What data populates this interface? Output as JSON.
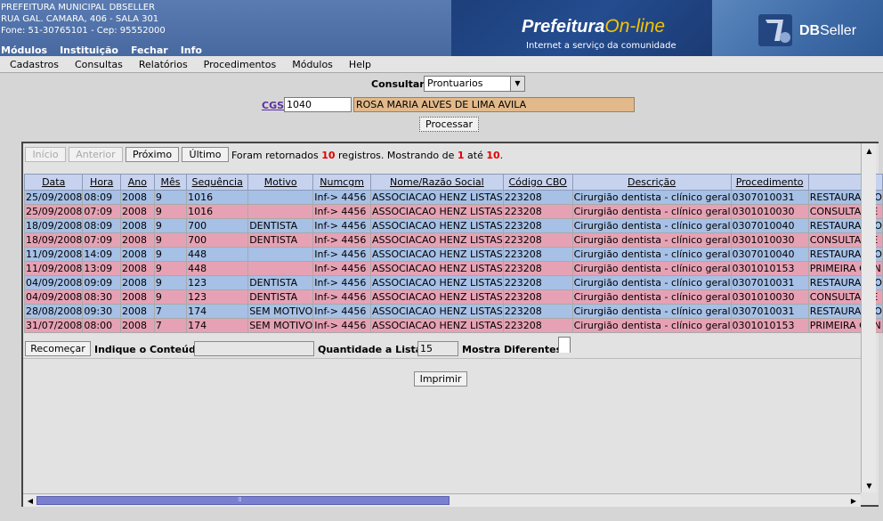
{
  "header": {
    "address_lines": [
      "PREFEITURA MUNICIPAL DBSELLER",
      "RUA GAL. CAMARA, 406 - SALA 301",
      "Fone: 51-30765101  -  Cep: 95552000"
    ],
    "top_menu": [
      "Módulos",
      "Instituição",
      "Fechar",
      "Info"
    ],
    "logo_part1": "Prefeitura",
    "logo_part2": "On-line",
    "logo_sub": "Internet a serviço da comunidade",
    "brand_db": "DB",
    "brand_seller": "Seller"
  },
  "menubar": [
    "Cadastros",
    "Consultas",
    "Relatórios",
    "Procedimentos",
    "Módulos",
    "Help"
  ],
  "form": {
    "consultar_label": "Consultar",
    "consultar_value": "Prontuarios",
    "cgs_label": "CGS",
    "cgs_value": "1040",
    "cgs_name": "ROSA MARIA ALVES DE LIMA AVILA",
    "processar": "Processar"
  },
  "nav": {
    "inicio": "Início",
    "anterior": "Anterior",
    "proximo": "Próximo",
    "ultimo": "Último",
    "info_prefix": "Foram retornados",
    "total": "10",
    "info_mid": "registros. Mostrando de",
    "from": "1",
    "info_to": "até",
    "to": "10",
    "period": "."
  },
  "table": {
    "columns": [
      "Data",
      "Hora",
      "Ano",
      "Mês",
      "Sequência",
      "Motivo",
      "Numcgm",
      "Nome/Razão Social",
      "Código CBO",
      "Descrição",
      "Procedimento",
      ""
    ],
    "rows": [
      [
        "25/09/2008",
        "08:09",
        "2008",
        "9",
        "1016",
        "",
        "Inf-> 4456",
        "ASSOCIACAO HENZ LISTAS",
        "223208",
        "Cirurgião dentista - clínico geral",
        "0307010031",
        "RESTAURACAO"
      ],
      [
        "25/09/2008",
        "07:09",
        "2008",
        "9",
        "1016",
        "",
        "Inf-> 4456",
        "ASSOCIACAO HENZ LISTAS",
        "223208",
        "Cirurgião dentista - clínico geral",
        "0301010030",
        "CONSULTA DE"
      ],
      [
        "18/09/2008",
        "08:09",
        "2008",
        "9",
        "700",
        "DENTISTA",
        "Inf-> 4456",
        "ASSOCIACAO HENZ LISTAS",
        "223208",
        "Cirurgião dentista - clínico geral",
        "0307010040",
        "RESTAURACAO"
      ],
      [
        "18/09/2008",
        "07:09",
        "2008",
        "9",
        "700",
        "DENTISTA",
        "Inf-> 4456",
        "ASSOCIACAO HENZ LISTAS",
        "223208",
        "Cirurgião dentista - clínico geral",
        "0301010030",
        "CONSULTA DE"
      ],
      [
        "11/09/2008",
        "14:09",
        "2008",
        "9",
        "448",
        "",
        "Inf-> 4456",
        "ASSOCIACAO HENZ LISTAS",
        "223208",
        "Cirurgião dentista - clínico geral",
        "0307010040",
        "RESTAURACAO"
      ],
      [
        "11/09/2008",
        "13:09",
        "2008",
        "9",
        "448",
        "",
        "Inf-> 4456",
        "ASSOCIACAO HENZ LISTAS",
        "223208",
        "Cirurgião dentista - clínico geral",
        "0301010153",
        "PRIMEIRA CON"
      ],
      [
        "04/09/2008",
        "09:09",
        "2008",
        "9",
        "123",
        "DENTISTA",
        "Inf-> 4456",
        "ASSOCIACAO HENZ LISTAS",
        "223208",
        "Cirurgião dentista - clínico geral",
        "0307010031",
        "RESTAURACAO"
      ],
      [
        "04/09/2008",
        "08:30",
        "2008",
        "9",
        "123",
        "DENTISTA",
        "Inf-> 4456",
        "ASSOCIACAO HENZ LISTAS",
        "223208",
        "Cirurgião dentista - clínico geral",
        "0301010030",
        "CONSULTA DE"
      ],
      [
        "28/08/2008",
        "09:30",
        "2008",
        "7",
        "174",
        "SEM MOTIVO",
        "Inf-> 4456",
        "ASSOCIACAO HENZ LISTAS",
        "223208",
        "Cirurgião dentista - clínico geral",
        "0307010031",
        "RESTAURACAO"
      ],
      [
        "31/07/2008",
        "08:00",
        "2008",
        "7",
        "174",
        "SEM MOTIVO",
        "Inf-> 4456",
        "ASSOCIACAO HENZ LISTAS",
        "223208",
        "Cirurgião dentista - clínico geral",
        "0301010153",
        "PRIMEIRA CON"
      ]
    ]
  },
  "footer": {
    "recomecar": "Recomeçar",
    "indique_label": "Indique o Conteúdo:",
    "indique_value": "",
    "quantidade_label": "Quantidade a Listar:",
    "quantidade_value": "15",
    "mostra_label": "Mostra Diferentes:",
    "imprimir": "Imprimir"
  },
  "colors": {
    "row_blue": "#a6c0e6",
    "row_pink": "#e6a2b4",
    "name_field": "#e2b98a",
    "header_bg": "#c7d3ee"
  }
}
